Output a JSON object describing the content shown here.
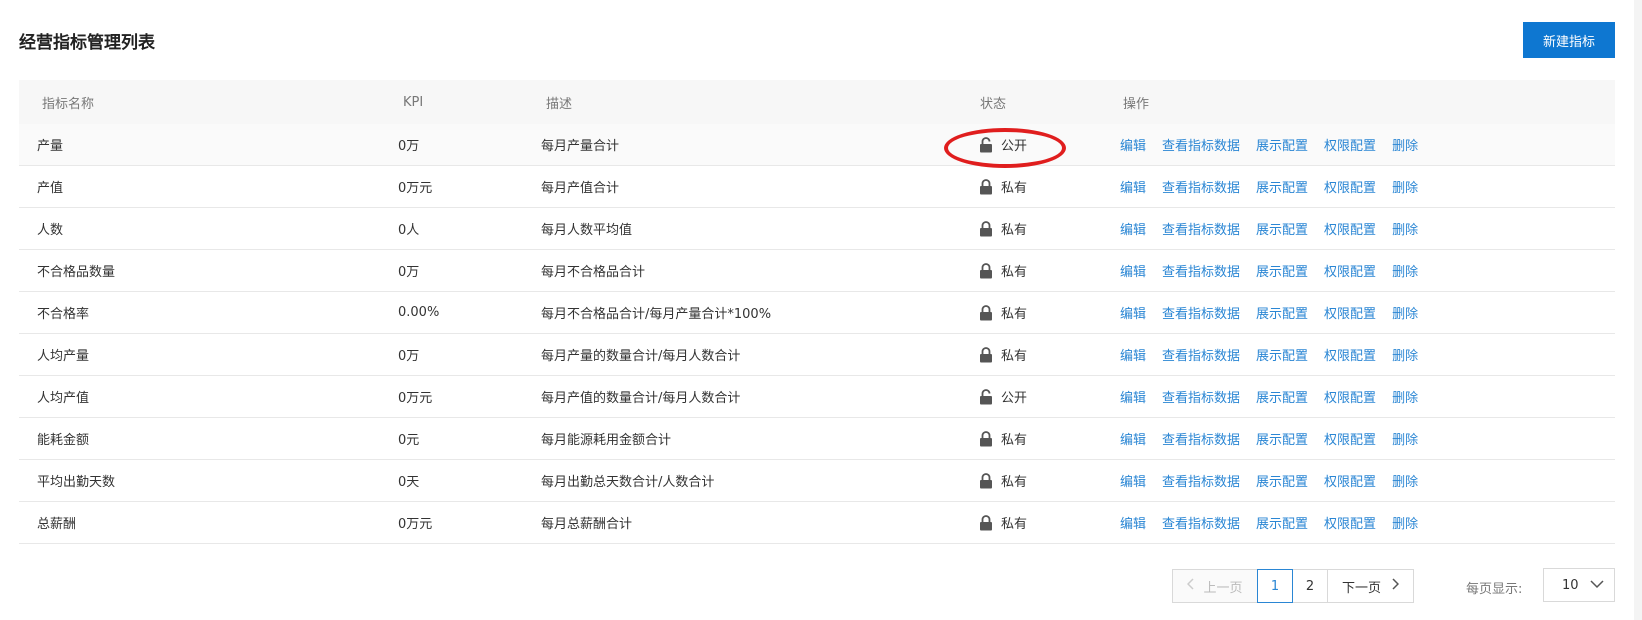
{
  "header": {
    "title": "经营指标管理列表",
    "new_button": "新建指标"
  },
  "table": {
    "columns": [
      "指标名称",
      "KPI",
      "描述",
      "状态",
      "操作"
    ],
    "operations": [
      "编辑",
      "查看指标数据",
      "展示配置",
      "权限配置",
      "删除"
    ],
    "rows": [
      {
        "name": "产量",
        "kpi": "0万",
        "desc": "每月产量合计",
        "status": "公开",
        "lock": "unlocked"
      },
      {
        "name": "产值",
        "kpi": "0万元",
        "desc": "每月产值合计",
        "status": "私有",
        "lock": "locked"
      },
      {
        "name": "人数",
        "kpi": "0人",
        "desc": "每月人数平均值",
        "status": "私有",
        "lock": "locked"
      },
      {
        "name": "不合格品数量",
        "kpi": "0万",
        "desc": "每月不合格品合计",
        "status": "私有",
        "lock": "locked"
      },
      {
        "name": "不合格率",
        "kpi": "0.00%",
        "desc": "每月不合格品合计/每月产量合计*100%",
        "status": "私有",
        "lock": "locked"
      },
      {
        "name": "人均产量",
        "kpi": "0万",
        "desc": "每月产量的数量合计/每月人数合计",
        "status": "私有",
        "lock": "locked"
      },
      {
        "name": "人均产值",
        "kpi": "0万元",
        "desc": "每月产值的数量合计/每月人数合计",
        "status": "公开",
        "lock": "unlocked"
      },
      {
        "name": "能耗金额",
        "kpi": "0元",
        "desc": "每月能源耗用金额合计",
        "status": "私有",
        "lock": "locked"
      },
      {
        "name": "平均出勤天数",
        "kpi": "0天",
        "desc": "每月出勤总天数合计/人数合计",
        "status": "私有",
        "lock": "locked"
      },
      {
        "name": "总薪酬",
        "kpi": "0万元",
        "desc": "每月总薪酬合计",
        "status": "私有",
        "lock": "locked"
      }
    ]
  },
  "pagination": {
    "prev": "上一页",
    "pages": [
      "1",
      "2"
    ],
    "current": "1",
    "next": "下一页",
    "per_page_label": "每页显示:",
    "per_page_value": "10"
  },
  "colors": {
    "primary": "#0e77d1",
    "link": "#2a86d4",
    "annotation": "#e01e1e"
  }
}
